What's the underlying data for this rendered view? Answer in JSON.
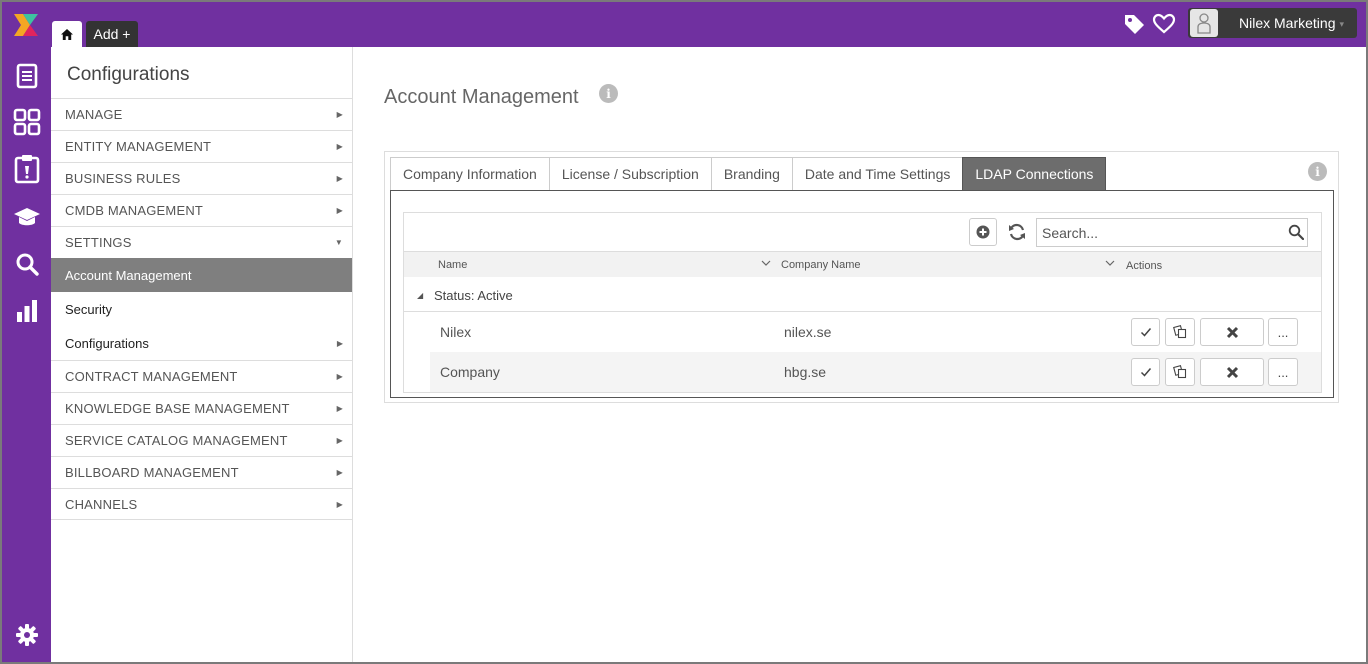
{
  "topbar": {
    "home_tab_icon": "home-icon",
    "add_tab_label": "Add +",
    "tag_icon": "tag-icon",
    "favorite_icon": "heart-icon",
    "user_name": "Nilex Marketing",
    "user_caret": "▾",
    "background": "#7030a0"
  },
  "rail": {
    "items": [
      "document-icon",
      "dashboard-icon",
      "clipboard-icon",
      "graduation-cap-icon",
      "search-icon",
      "bar-chart-icon"
    ],
    "bottom": "gear-icon"
  },
  "sidemenu": {
    "title": "Configurations",
    "sections_top": [
      {
        "label": "MANAGE",
        "arrow": "▶"
      },
      {
        "label": "ENTITY MANAGEMENT",
        "arrow": "▶"
      },
      {
        "label": "BUSINESS RULES",
        "arrow": "▶"
      },
      {
        "label": "CMDB MANAGEMENT",
        "arrow": "▶"
      },
      {
        "label": "SETTINGS",
        "arrow": "▼"
      }
    ],
    "settings_children": [
      {
        "label": "Account Management",
        "active": true
      },
      {
        "label": "Security"
      },
      {
        "label": "Configurations",
        "arrow": "▶"
      }
    ],
    "sections_bottom": [
      {
        "label": "CONTRACT MANAGEMENT",
        "arrow": "▶"
      },
      {
        "label": "KNOWLEDGE BASE MANAGEMENT",
        "arrow": "▶"
      },
      {
        "label": "SERVICE CATALOG MANAGEMENT",
        "arrow": "▶"
      },
      {
        "label": "BILLBOARD MANAGEMENT",
        "arrow": "▶"
      },
      {
        "label": "CHANNELS",
        "arrow": "▶"
      }
    ]
  },
  "main": {
    "title": "Account Management",
    "info_glyph": "i",
    "tabs": [
      {
        "label": "Company Information"
      },
      {
        "label": "License / Subscription"
      },
      {
        "label": "Branding"
      },
      {
        "label": "Date and Time Settings"
      },
      {
        "label": "LDAP Connections",
        "active": true
      }
    ],
    "grid": {
      "search_placeholder": "Search...",
      "columns": {
        "name": "Name",
        "company": "Company Name",
        "actions": "Actions"
      },
      "group_caret": "◢",
      "group_label": "Status: Active",
      "rows": [
        {
          "name": "Nilex",
          "company": "nilex.se"
        },
        {
          "name": "Company",
          "company": "hbg.se"
        }
      ],
      "action_more_label": "..."
    }
  }
}
